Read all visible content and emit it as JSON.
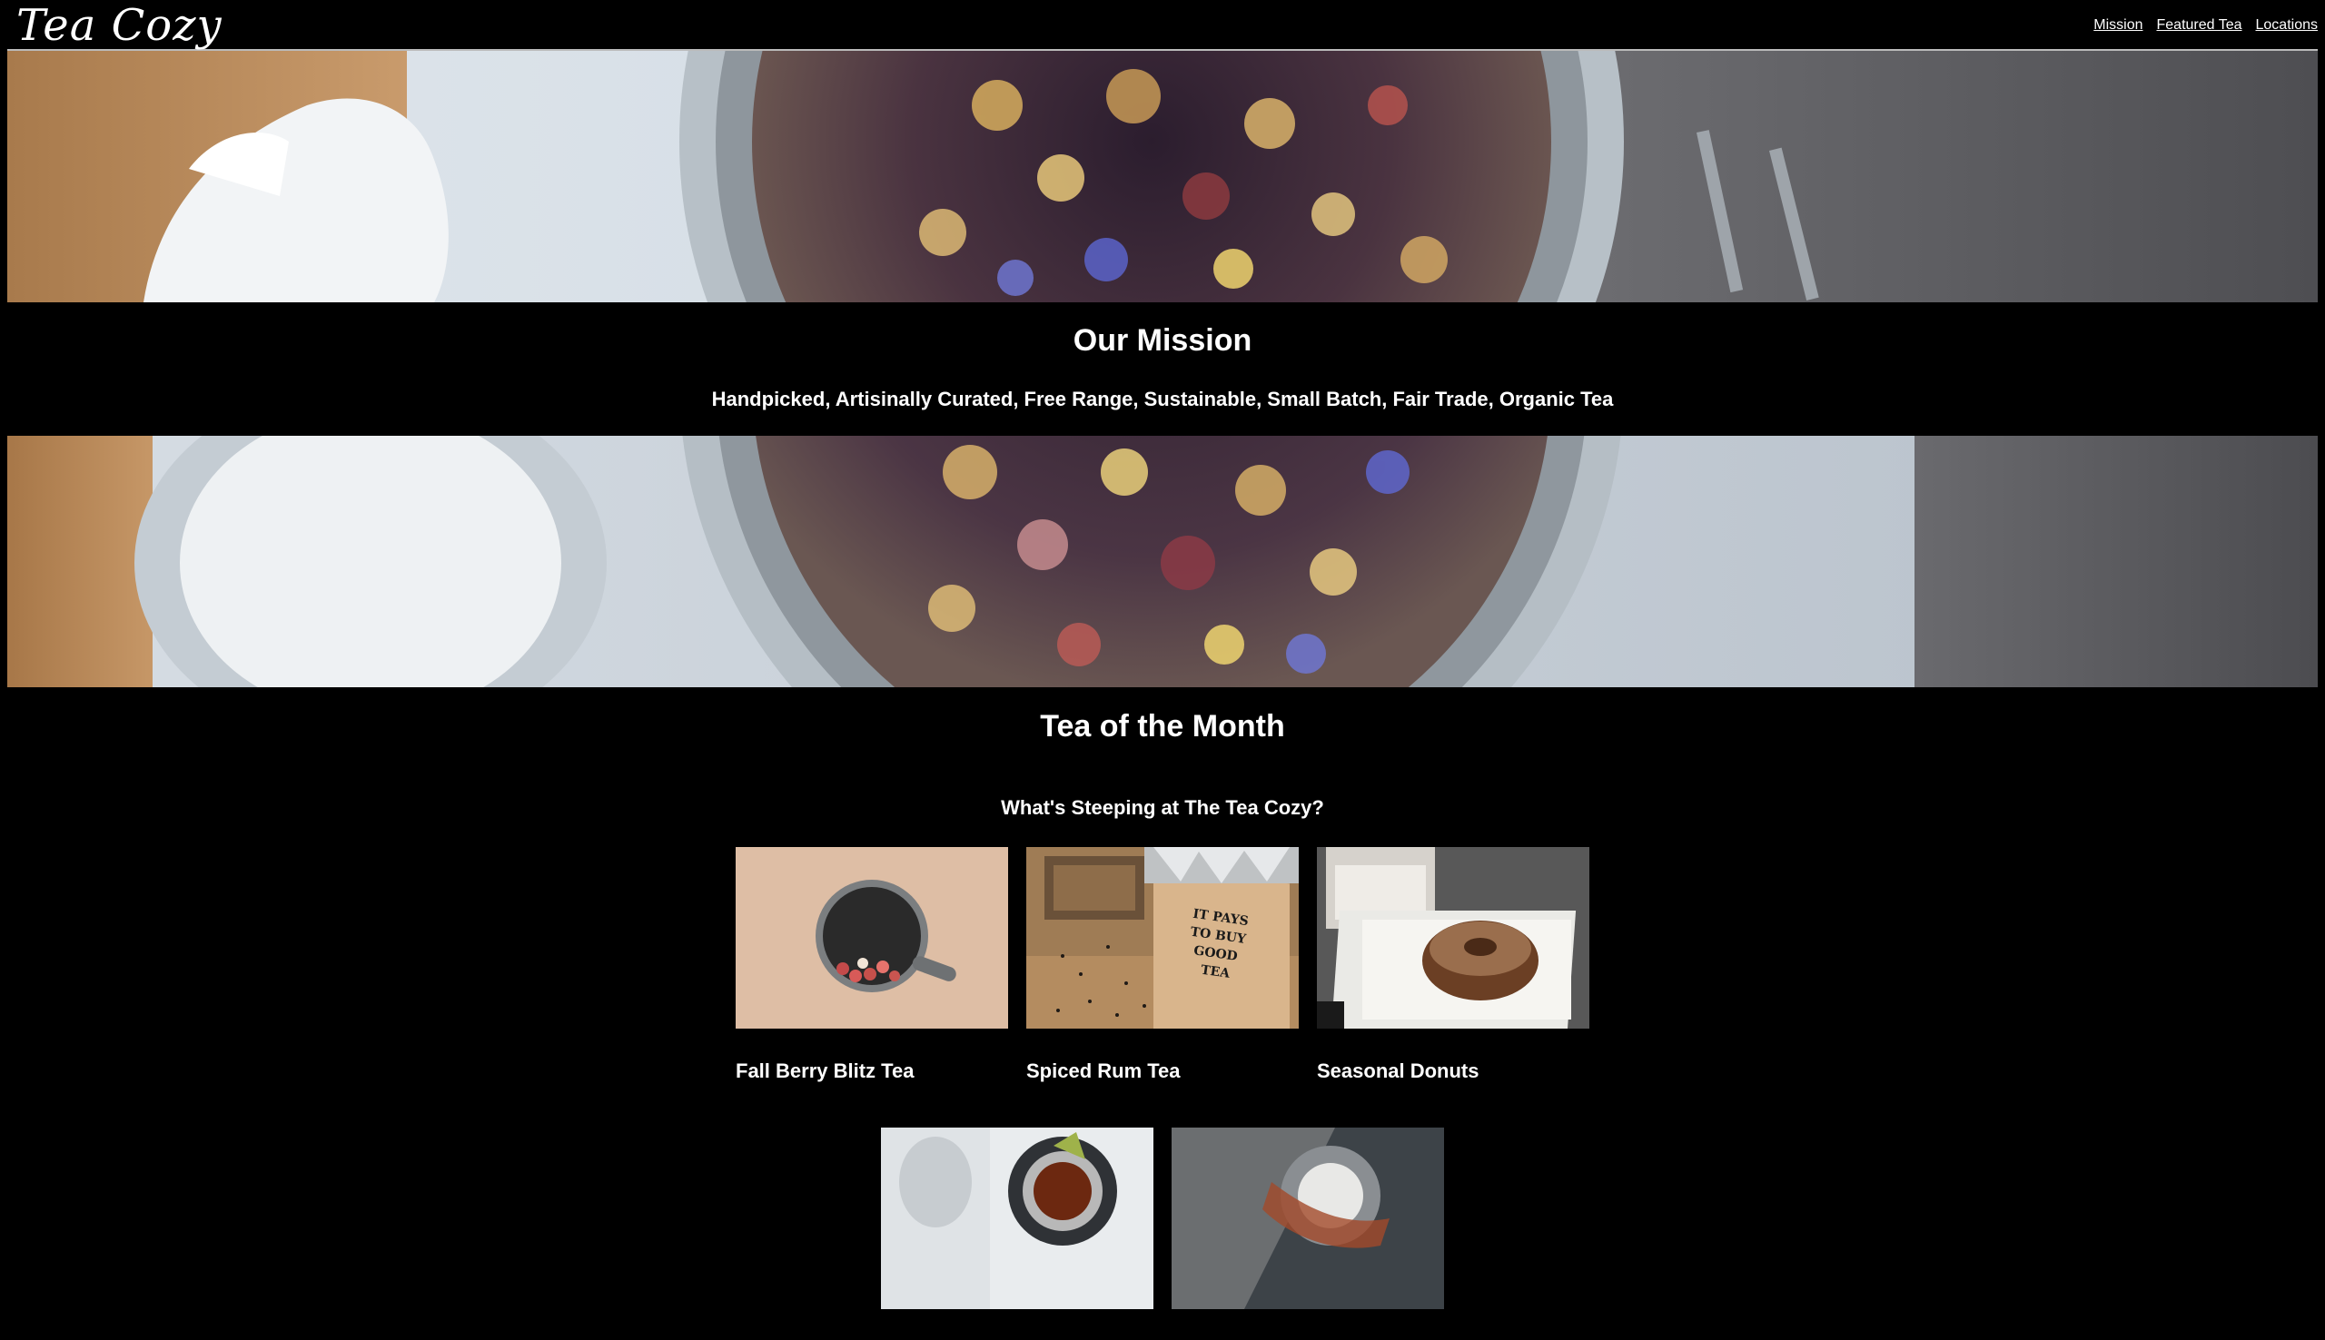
{
  "header": {
    "logo": "Tea Cozy",
    "nav": [
      {
        "label": "Mission"
      },
      {
        "label": "Featured Tea"
      },
      {
        "label": "Locations"
      }
    ]
  },
  "mission": {
    "title": "Our Mission",
    "text": "Handpicked, Artisinally Curated, Free Range, Sustainable, Small Batch, Fair Trade, Organic Tea"
  },
  "month": {
    "title": "Tea of the Month",
    "subtitle": "What's Steeping at The Tea Cozy?",
    "items": [
      {
        "name": "Fall Berry Blitz Tea",
        "image_text": ""
      },
      {
        "name": "Spiced Rum Tea",
        "image_text": "IT PAYS TO BUY GOOD TEA"
      },
      {
        "name": "Seasonal Donuts",
        "image_text": ""
      },
      {
        "name": ""
      },
      {
        "name": ""
      }
    ]
  },
  "colors": {
    "background": "#000000",
    "text": "#ffffff",
    "header_rule": "#bbbbbb"
  }
}
